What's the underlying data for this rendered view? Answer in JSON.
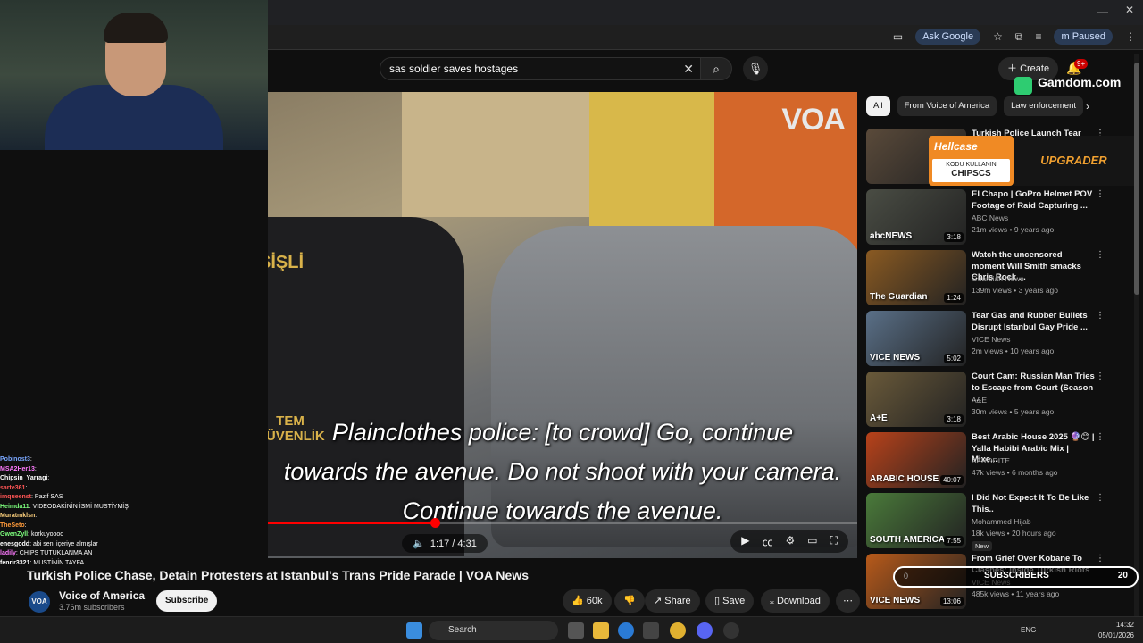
{
  "browser": {
    "ask_google": "Ask Google",
    "profile_status": "Paused",
    "profile_initial": "m"
  },
  "search": {
    "query": "sas soldier saves hostages"
  },
  "header": {
    "create_label": "Create",
    "notif_count": "9+"
  },
  "video": {
    "watermark": "VOA",
    "subtitle_lines": [
      "Plainclothes police: [to crowd] Go, continue",
      "towards the avenue. Do not shoot with your camera.",
      "Continue towards the avenue."
    ],
    "time": "1:17 / 4:31",
    "progress_fraction": 0.284,
    "police_vest_top": "ŞİŞLİ",
    "police_vest_bottom": "TEM GÜVENLİK",
    "title": "Turkish Police Chase, Detain Protesters at Istanbul's Trans Pride Parade | VOA News",
    "channel": "Voice of America",
    "channel_avatar": "VOA",
    "subscribers": "3.76m subscribers",
    "subscribe_label": "Subscribe",
    "likes": "60k",
    "share_label": "Share",
    "save_label": "Save",
    "download_label": "Download"
  },
  "chips": [
    {
      "label": "All",
      "active": true
    },
    {
      "label": "From Voice of America",
      "active": false
    },
    {
      "label": "Law enforcement",
      "active": false
    }
  ],
  "recommendations": [
    {
      "title": "Turkish Police Launch Tear Gas ...",
      "channel": "",
      "meta": "",
      "duration": "",
      "thumb_label": "",
      "thumb_color": "#5a4a3a"
    },
    {
      "title": "El Chapo | GoPro Helmet POV Footage of Raid Capturing ...",
      "channel": "ABC News",
      "meta": "21m views • 9 years ago",
      "duration": "3:18",
      "thumb_label": "abcNEWS",
      "thumb_color": "#4a4d44"
    },
    {
      "title": "Watch the uncensored moment Will Smith smacks Chris Rock ...",
      "channel": "Guardian News",
      "meta": "139m views • 3 years ago",
      "duration": "1:24",
      "thumb_label": "The Guardian",
      "thumb_color": "#8a5a22"
    },
    {
      "title": "Tear Gas and Rubber Bullets Disrupt Istanbul Gay Pride ...",
      "channel": "VICE News",
      "meta": "2m views • 10 years ago",
      "duration": "5:02",
      "thumb_label": "VICE NEWS",
      "thumb_color": "#5a7088"
    },
    {
      "title": "Court Cam: Russian Man Tries to Escape from Court (Season ...",
      "channel": "A&E",
      "meta": "30m views • 5 years ago",
      "duration": "3:18",
      "thumb_label": "A+E",
      "thumb_color": "#6a5a3a"
    },
    {
      "title": "Best Arabic House 2025 🔮😊 | Yalla Habibi Arabic Mix | Mixe...",
      "channel": "AFRODITE",
      "meta": "47k views • 6 months ago",
      "duration": "40:07",
      "thumb_label": "ARABIC HOUSE",
      "thumb_color": "#b8421a"
    },
    {
      "title": "I Did Not Expect It To Be Like This..",
      "channel": "Mohammed Hijab",
      "meta": "18k views • 20 hours ago",
      "duration": "7:55",
      "thumb_label": "SOUTH AMERICA",
      "thumb_color": "#4a7a3a",
      "badge": "New"
    },
    {
      "title": "From Grief Over Kobane To Clashes: Inside Turkish Riots",
      "channel": "VICE News",
      "meta": "485k views • 11 years ago",
      "duration": "13:06",
      "thumb_label": "VICE NEWS",
      "thumb_color": "#b85a1a"
    }
  ],
  "ads": {
    "gamdom": "Gamdom.com",
    "hellcase": "Hellcase",
    "hellcase_line1": "KODU KULLANIN",
    "hellcase_code": "CHIPSCS",
    "upgrader": "UPGRADER",
    "subs_label": "SUBSCRIBERS",
    "subs_left": "0",
    "subs_right": "20"
  },
  "chat": [
    {
      "nick": "Pobinost3",
      "text": ":",
      "color": "#7aa7ff"
    },
    {
      "nick": "MSA2Her13",
      "text": ":",
      "color": "#ff7aff"
    },
    {
      "nick": "Chipsin_Yarragi",
      "text": ":",
      "color": "#ffffff"
    },
    {
      "nick": "sarte361",
      "text": ":",
      "color": "#ff5555"
    },
    {
      "nick": "imqueenst",
      "text": ": Pazif SAS",
      "color": "#ff5555"
    },
    {
      "nick": "Heimda11",
      "text": ": VIDEODAKİNİN İSMİ MUSTİYMİŞ",
      "color": "#7dff7d"
    },
    {
      "nick": "Muratmklsn",
      "text": ":",
      "color": "#ffd27d"
    },
    {
      "nick": "TheSeto",
      "text": ":",
      "color": "#ff9a3a"
    },
    {
      "nick": "GwenZyll",
      "text": ": korkuyoooo",
      "color": "#7dff7d"
    },
    {
      "nick": "enesgodd",
      "text": ": abi seni içeriye almışlar",
      "color": "#ffffff"
    },
    {
      "nick": "ladily",
      "text": ": CHIPS TUTUKLANMA AN",
      "color": "#ff7aff"
    },
    {
      "nick": "fenrir3321",
      "text": ": MUSTİNİN TAYFA",
      "color": "#ffffff"
    }
  ],
  "taskbar": {
    "search_placeholder": "Search",
    "lang": "ENG",
    "time": "14:32",
    "date": "05/01/2026"
  }
}
